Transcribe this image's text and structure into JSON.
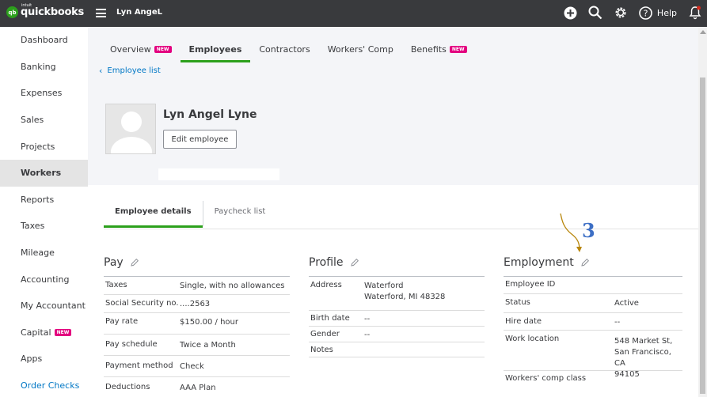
{
  "topbar": {
    "logo_small": "intuit",
    "logo_main": "quickbooks",
    "logo_badge": "qb",
    "company": "Lyn AngeL",
    "help_label": "Help",
    "icons": [
      "plus-icon",
      "search-icon",
      "gear-icon",
      "help-icon",
      "bell-icon"
    ]
  },
  "sidebar": {
    "items": [
      {
        "label": "Dashboard"
      },
      {
        "label": "Banking"
      },
      {
        "label": "Expenses"
      },
      {
        "label": "Sales"
      },
      {
        "label": "Projects"
      },
      {
        "label": "Workers",
        "active": true
      },
      {
        "label": "Reports"
      },
      {
        "label": "Taxes"
      },
      {
        "label": "Mileage"
      },
      {
        "label": "Accounting"
      },
      {
        "label": "My Accountant"
      },
      {
        "label": "Capital",
        "badge": "NEW"
      },
      {
        "label": "Apps"
      },
      {
        "label": "Order Checks",
        "link": true
      }
    ]
  },
  "tabs": [
    {
      "label": "Overview",
      "badge": "NEW"
    },
    {
      "label": "Employees",
      "active": true
    },
    {
      "label": "Contractors"
    },
    {
      "label": "Workers' Comp"
    },
    {
      "label": "Benefits",
      "badge": "NEW"
    }
  ],
  "back_link": "Employee list",
  "employee": {
    "name": "Lyn Angel Lyne",
    "edit_button": "Edit employee"
  },
  "subtabs": [
    {
      "label": "Employee details",
      "active": true
    },
    {
      "label": "Paycheck list"
    }
  ],
  "pay": {
    "title": "Pay",
    "rows": [
      {
        "label": "Taxes",
        "value": "Single, with no allowances"
      },
      {
        "label": "Social Security no.",
        "value": "....2563"
      },
      {
        "label": "Pay rate",
        "value": "$150.00 / hour"
      },
      {
        "label": "Pay schedule",
        "value": "Twice a Month"
      },
      {
        "label": "Payment method",
        "value": "Check"
      },
      {
        "label": "Deductions",
        "value": "AAA Plan"
      }
    ]
  },
  "profile": {
    "title": "Profile",
    "rows": [
      {
        "label": "Address",
        "value": "Waterford\nWaterford, MI 48328"
      },
      {
        "label": "Birth date",
        "value": "--"
      },
      {
        "label": "Gender",
        "value": "--"
      },
      {
        "label": "Notes",
        "value": ""
      }
    ]
  },
  "employment": {
    "title": "Employment",
    "rows": [
      {
        "label": "Employee ID",
        "value": ""
      },
      {
        "label": "Status",
        "value": "Active"
      },
      {
        "label": "Hire date",
        "value": "--"
      },
      {
        "label": "Work location",
        "value": "548 Market St,\nSan Francisco, CA\n94105"
      },
      {
        "label": "Workers' comp class",
        "value": ""
      }
    ]
  },
  "annotation": {
    "number": "3",
    "color": "#3d6fc5",
    "arrow_color": "#b8860b"
  },
  "colors": {
    "brand_green": "#2ca01c",
    "link_blue": "#0077c5",
    "new_badge": "#e3007f",
    "topbar": "#393a3d"
  }
}
